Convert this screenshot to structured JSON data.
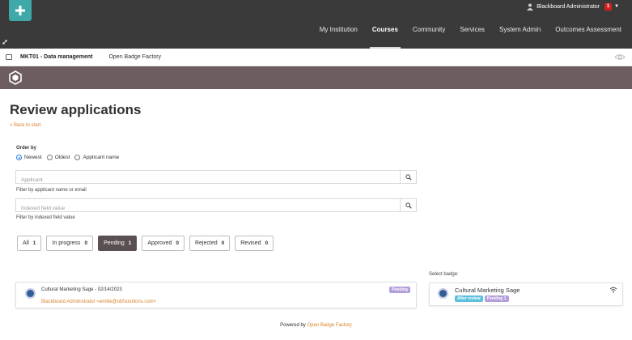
{
  "header": {
    "user_name": "Blackboard Administrator",
    "notification_count": "1",
    "nav": [
      {
        "label": "My Institution",
        "active": false
      },
      {
        "label": "Courses",
        "active": true
      },
      {
        "label": "Community",
        "active": false
      },
      {
        "label": "Services",
        "active": false
      },
      {
        "label": "System Admin",
        "active": false
      },
      {
        "label": "Outcomes Assessment",
        "active": false
      }
    ]
  },
  "breadcrumb": {
    "course": "MKT01 - Data management",
    "page": "Open Badge Factory"
  },
  "main": {
    "title": "Review applications",
    "back_link": "« Back to start",
    "order_by": {
      "label": "Order by",
      "options": [
        {
          "label": "Newest",
          "selected": true
        },
        {
          "label": "Oldest",
          "selected": false
        },
        {
          "label": "Applicant name",
          "selected": false
        }
      ]
    },
    "applicant_filter": {
      "placeholder": "Applicant",
      "help": "Filter by applicant name or email"
    },
    "indexed_filter": {
      "placeholder": "Indexed field value",
      "help": "Filter by indexed field value"
    },
    "status_filters": [
      {
        "label": "All",
        "count": "1",
        "active": false
      },
      {
        "label": "In progress",
        "count": "0",
        "active": false
      },
      {
        "label": "Pending",
        "count": "1",
        "active": true
      },
      {
        "label": "Approved",
        "count": "0",
        "active": false
      },
      {
        "label": "Rejected",
        "count": "0",
        "active": false
      },
      {
        "label": "Revised",
        "count": "0",
        "active": false
      }
    ],
    "application": {
      "title": "Cultural Marketing Sage - 02/14/2023",
      "applicant": "Blackboard Administrator <emilie@obfsolutions.com>",
      "status": "Pending"
    },
    "select_badge": {
      "label": "Select badge:",
      "badge_name": "Cultural Marketing Sage",
      "tag_after_review": "After review",
      "tag_pending": "Pending 1"
    }
  },
  "footer": {
    "prefix": "Powered by ",
    "link": "Open Badge Factory"
  },
  "colors": {
    "header_bg": "#3a3a3a",
    "banner_bg": "#6d5d5e",
    "accent_orange": "#d9822b",
    "pending_purple": "#b39ddb",
    "after_review_blue": "#5bc0de",
    "logo_teal": "#3fa9a9"
  }
}
